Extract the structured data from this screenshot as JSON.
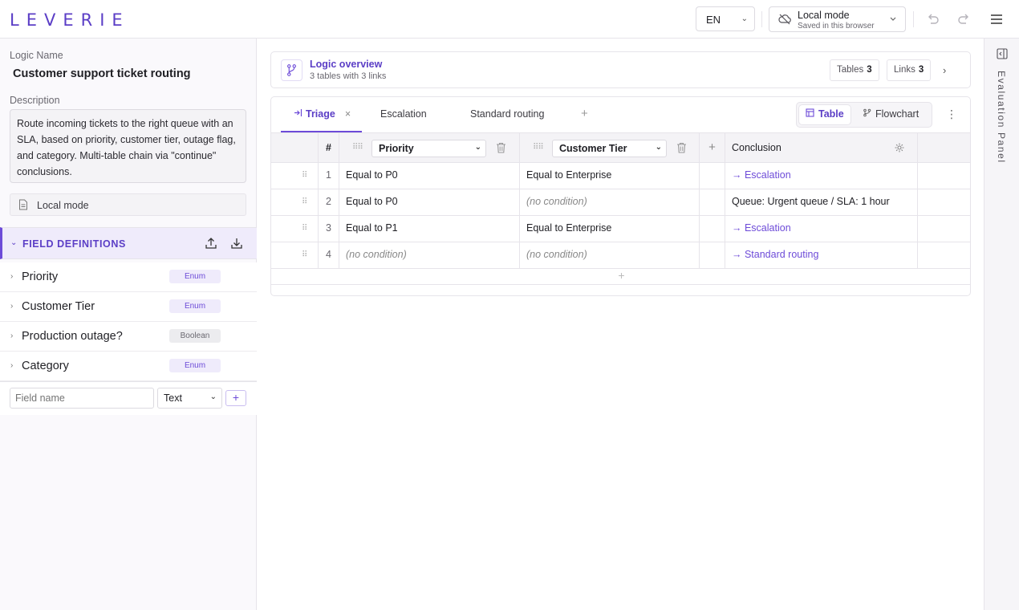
{
  "app": {
    "logo": "LEVERIE"
  },
  "topbar": {
    "language": "EN",
    "mode_title": "Local mode",
    "mode_subtitle": "Saved in this browser",
    "icons": [
      "cloud-off-icon",
      "undo-icon",
      "redo-icon",
      "menu-icon"
    ]
  },
  "sidebar": {
    "logic_name_label": "Logic Name",
    "logic_name": "Customer support ticket routing",
    "description_label": "Description",
    "description": "Route incoming tickets to the right queue with an SLA, based on priority, customer tier, outage flag, and category. Multi-table chain via \"continue\" conclusions.",
    "local_mode": "Local mode",
    "field_definitions_title": "FIELD DEFINITIONS",
    "fields": [
      {
        "name": "Priority",
        "type": "Enum"
      },
      {
        "name": "Customer Tier",
        "type": "Enum"
      },
      {
        "name": "Production outage?",
        "type": "Boolean"
      },
      {
        "name": "Category",
        "type": "Enum"
      }
    ],
    "new_field": {
      "placeholder": "Field name",
      "type": "Text",
      "add": "+"
    }
  },
  "overview": {
    "title": "Logic overview",
    "subtitle": "3 tables with 3 links",
    "tables_label": "Tables",
    "tables_count": "3",
    "links_label": "Links",
    "links_count": "3",
    "arrow": "›"
  },
  "tabs": [
    {
      "label": "Triage",
      "active": true,
      "close": "×"
    },
    {
      "label": "Escalation"
    },
    {
      "label": "Standard routing"
    }
  ],
  "tab_add": "+",
  "view_toggle": {
    "table": "Table",
    "flowchart": "Flowchart"
  },
  "table": {
    "num_header": "#",
    "columns": [
      "Priority",
      "Customer Tier"
    ],
    "add_column": "+",
    "conclusion_header": "Conclusion",
    "rows": [
      {
        "n": "1",
        "c1": "Equal to P0",
        "c2": "Equal to Enterprise",
        "conclusion": "→ Escalation"
      },
      {
        "n": "2",
        "c1": "Equal to P0",
        "c2": "(no condition)",
        "conclusion": "Queue: Urgent queue / SLA: 1 hour"
      },
      {
        "n": "3",
        "c1": "Equal to P1",
        "c2": "Equal to Enterprise",
        "conclusion": "→ Escalation"
      },
      {
        "n": "4",
        "c1": "(no condition)",
        "c2": "(no condition)",
        "conclusion": "→ Standard routing"
      }
    ],
    "add_row": "+"
  },
  "right_panel": {
    "title": "Evaluation Panel"
  },
  "colors": {
    "accent": "#6d4bd8",
    "accent_dark": "#5b3ec6",
    "border": "#e6e4ea"
  }
}
